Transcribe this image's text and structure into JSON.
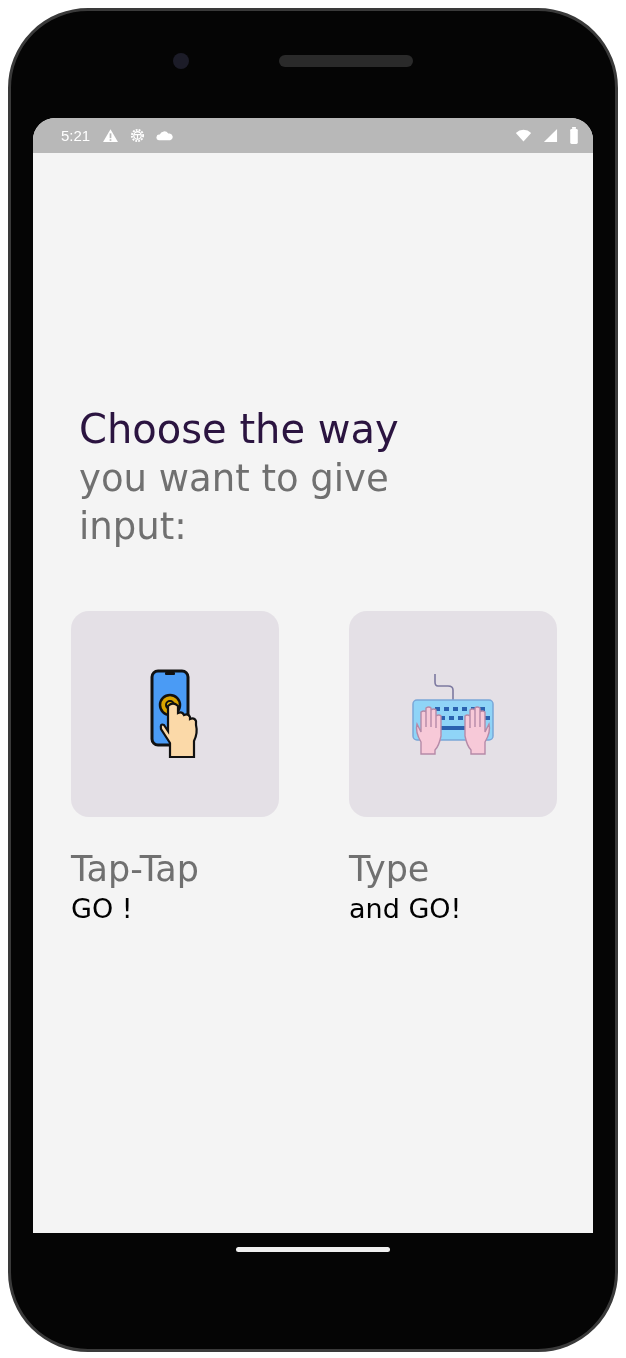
{
  "status_bar": {
    "time": "5:21"
  },
  "heading": {
    "title": "Choose the way",
    "subtitle": "you want to give input:"
  },
  "options": [
    {
      "kind": "tap",
      "title": "Tap-Tap",
      "caption": "GO !"
    },
    {
      "kind": "type",
      "title": "Type",
      "caption": "and GO!"
    }
  ]
}
